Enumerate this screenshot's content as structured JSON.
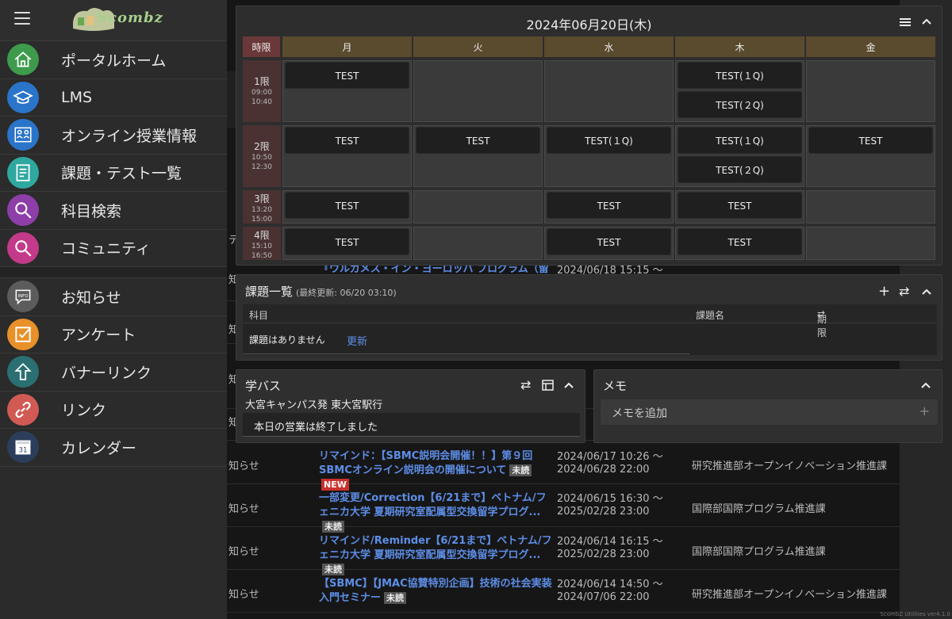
{
  "sidebar": {
    "logo_text": "Scombz",
    "items": [
      {
        "label": "ポータルホーム",
        "icon": "home-icon",
        "color": "#3e9b4c"
      },
      {
        "label": "LMS",
        "icon": "graduation-cap-icon",
        "color": "#2a74c9"
      },
      {
        "label": "オンライン授業情報",
        "icon": "online-class-icon",
        "color": "#2a74c9"
      },
      {
        "label": "課題・テスト一覧",
        "icon": "document-list-icon",
        "color": "#2fa8a0"
      },
      {
        "label": "科目検索",
        "icon": "magnifier-icon",
        "color": "#8e3ea8"
      },
      {
        "label": "コミュニティ",
        "icon": "magnifier-icon",
        "color": "#c43a8a"
      },
      {
        "label": "お知らせ",
        "icon": "info-bubble-icon",
        "color": "#5c5c5c"
      },
      {
        "label": "アンケート",
        "icon": "checkbox-icon",
        "color": "#e8912a"
      },
      {
        "label": "バナーリンク",
        "icon": "arrow-up-icon",
        "color": "#2a6f72"
      },
      {
        "label": "リンク",
        "icon": "chain-link-icon",
        "color": "#d25a54"
      },
      {
        "label": "カレンダー",
        "icon": "calendar-icon",
        "color": "#2b3f5c"
      }
    ]
  },
  "timetable": {
    "date": "2024年06月20日(木)",
    "period_header": "時限",
    "days": [
      "月",
      "火",
      "水",
      "木",
      "金"
    ],
    "periods": [
      {
        "name": "1限",
        "start": "09:00",
        "end": "10:40"
      },
      {
        "name": "2限",
        "start": "10:50",
        "end": "12:30"
      },
      {
        "name": "3限",
        "start": "13:20",
        "end": "15:00"
      },
      {
        "name": "4限",
        "start": "15:10",
        "end": "16:50"
      }
    ],
    "classes": [
      [
        [
          "TEST"
        ],
        [],
        [],
        [
          "TEST(１Q)",
          "TEST(２Q)"
        ],
        []
      ],
      [
        [
          "TEST"
        ],
        [
          "TEST"
        ],
        [
          "TEST(１Q)"
        ],
        [
          "TEST(１Q)",
          "TEST(２Q)"
        ],
        [
          "TEST"
        ]
      ],
      [
        [
          "TEST"
        ],
        [],
        [
          "TEST"
        ],
        [
          "TEST"
        ],
        []
      ],
      [
        [
          "TEST"
        ],
        [],
        [
          "TEST"
        ],
        [
          "TEST"
        ],
        []
      ]
    ]
  },
  "tasks": {
    "title": "課題一覧",
    "updated": "(最終更新: 06/20 03:10)",
    "col_subject": "科目",
    "col_task": "課題名",
    "col_deadline": "期限",
    "empty": "課題はありません",
    "refresh": "更新"
  },
  "bus": {
    "title": "学バス",
    "route": "大宮キャンパス発 東大宮駅行",
    "status": "本日の営業は終了しました"
  },
  "memo": {
    "title": "メモ",
    "placeholder": "メモを追加"
  },
  "notices": [
    {
      "cat": "知らせ",
      "title": "リマインド：【SBMC説明会開催！！】第９回SBMCオンライン説明会の開催について",
      "unread": "未読",
      "new": "NEW",
      "date1": "2024/06/17 10:26 〜",
      "date2": "2024/06/28 22:00",
      "dept": "研究推進部オープンイノベーション推進課"
    },
    {
      "cat": "知らせ",
      "title": "一部変更/Correction【6/21まで】ベトナム/フェニカ大学 夏期研究室配属型交換留学プログ...",
      "unread": "未読",
      "new": "",
      "date1": "2024/06/15 16:30 〜",
      "date2": "2025/02/28 23:00",
      "dept": "国際部国際プログラム推進課"
    },
    {
      "cat": "知らせ",
      "title": "リマインド/Reminder【6/21まで】ベトナム/フェニカ大学 夏期研究室配属型交換留学プログ...",
      "unread": "未読",
      "new": "",
      "date1": "2024/06/14 16:15 〜",
      "date2": "2025/02/28 23:00",
      "dept": "国際部国際プログラム推進課"
    },
    {
      "cat": "知らせ",
      "title": "【SBMC】【JMAC協賛特別企画】技術の社会実装入門セミナー",
      "unread": "未読",
      "new": "",
      "date1": "2024/06/14 14:50 〜",
      "date2": "2024/07/06 22:00",
      "dept": "研究推進部オープンイノベーション推進課"
    }
  ],
  "hidden_notice_fragments": {
    "row_a_title": "『ウルカメス・イン・ヨーロッパ プログラム（留学留",
    "row_a_date": "2024/06/18 15:15 〜",
    "left_cats": [
      "テ",
      "知",
      "知",
      "知",
      "知"
    ]
  },
  "watermark": "ScombZ Utilities ver4.1.0"
}
